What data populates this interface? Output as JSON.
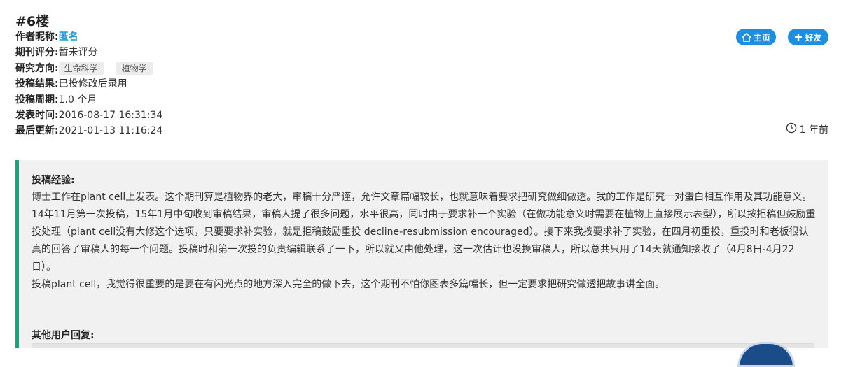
{
  "post": {
    "floor": "#6楼",
    "author_label": "作者昵称:",
    "author_name": "匿名",
    "rating_label": "期刊评分:",
    "rating_value": "暂未评分",
    "direction_label": "研究方向:",
    "direction_tags": [
      "生命科学",
      "植物学"
    ],
    "result_label": "投稿结果:",
    "result_value": "已投修改后录用",
    "cycle_label": "投稿周期:",
    "cycle_value": "1.0 个月",
    "published_label": "发表时间:",
    "published_value": "2016-08-17 16:31:34",
    "updated_label": "最后更新:",
    "updated_value": "2021-01-13 11:16:24",
    "time_ago": "1 年前"
  },
  "actions": {
    "home_label": "主页",
    "friend_label": "好友"
  },
  "experience": {
    "title": "投稿经验:",
    "paragraphs": [
      "博士工作在plant cell上发表。这个期刊算是植物界的老大，审稿十分严谨，允许文章篇幅较长，也就意味着要求把研究做细做透。我的工作是研究一对蛋白相互作用及其功能意义。14年11月第一次投稿，15年1月中旬收到审稿结果，审稿人提了很多问题，水平很高，同时由于要求补一个实验（在做功能意义时需要在植物上直接展示表型），所以按拒稿但鼓励重投处理（plant cell没有大修这个选项，只要要求补实验，就是拒稿鼓励重投 decline-resubmission encouraged）。接下来我按要求补了实验，在四月初重投，重投时和老板很认真的回答了审稿人的每一个问题。投稿时和第一次投的负责编辑联系了一下，所以就又由他处理，这一次估计也没换审稿人，所以总共只用了14天就通知接收了（4月8日-4月22日）。",
      "投稿plant cell，我觉得很重要的是要在有闪光点的地方深入完全的做下去，这个期刊不怕你图表多篇幅长，但一定要求把研究做透把故事讲全面。"
    ]
  },
  "replies": {
    "title": "其他用户回复:"
  },
  "colors": {
    "accent_blue": "#1e8fe0",
    "author_link": "#1e9ad8",
    "border_green": "#1aa37f",
    "box_bg": "#f1f1f1"
  }
}
